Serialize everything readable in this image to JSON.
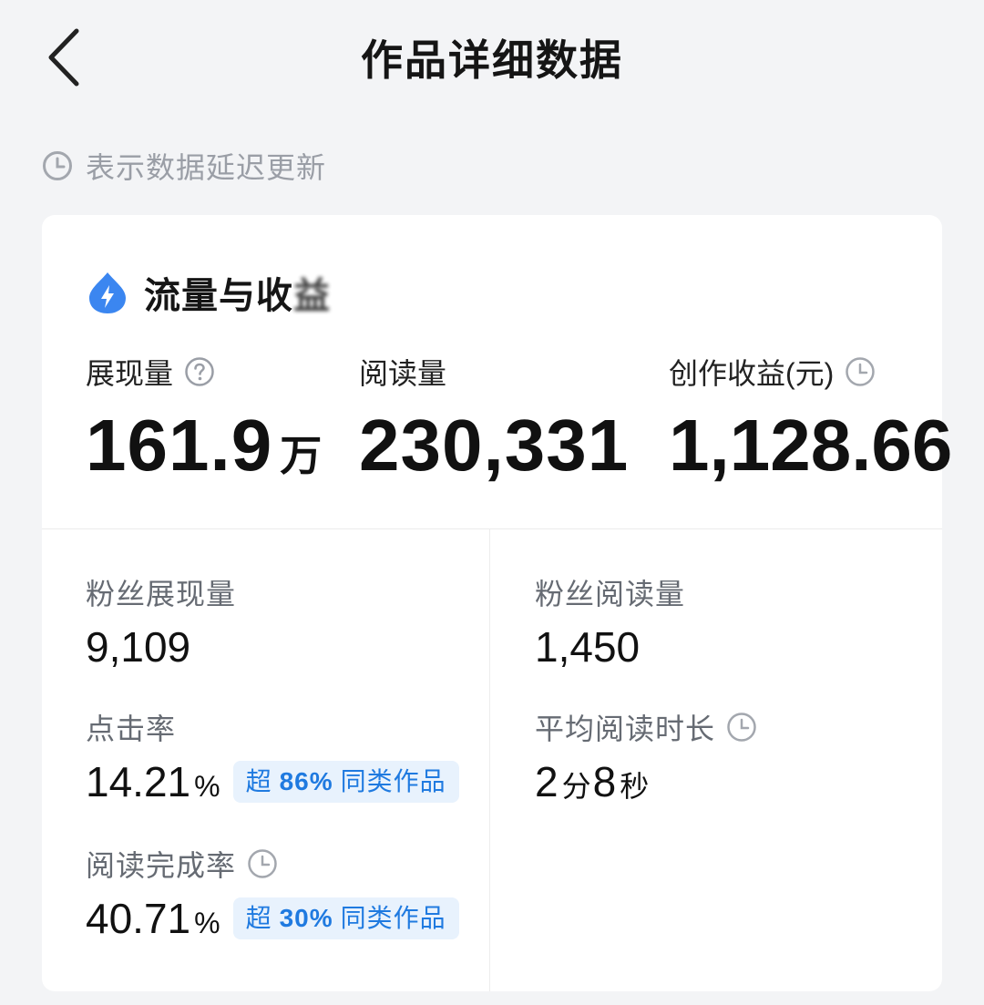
{
  "header": {
    "title": "作品详细数据"
  },
  "notice": {
    "text": "表示数据延迟更新"
  },
  "card": {
    "title": "流量与收",
    "title_blurred_char": "益",
    "metrics": [
      {
        "label": "展现量",
        "value": "161.9",
        "unit": "万"
      },
      {
        "label": "阅读量",
        "value": "230,331"
      },
      {
        "label": "创作收益(元)",
        "value": "1,128.66"
      }
    ],
    "fans_impressions": {
      "label": "粉丝展现量",
      "value": "9,109"
    },
    "fans_reads": {
      "label": "粉丝阅读量",
      "value": "1,450"
    },
    "ctr": {
      "label": "点击率",
      "value": "14.21",
      "unit": "%",
      "badge_prefix": "超",
      "badge_pct": "86%",
      "badge_suffix": "同类作品"
    },
    "avg_read_time": {
      "label": "平均阅读时长",
      "min": "2",
      "min_unit": "分",
      "sec": "8",
      "sec_unit": "秒"
    },
    "completion": {
      "label": "阅读完成率",
      "value": "40.71",
      "unit": "%",
      "badge_prefix": "超",
      "badge_pct": "30%",
      "badge_suffix": "同类作品"
    }
  },
  "colors": {
    "accent": "#1f7ae0",
    "badge_bg": "#e8f2fd",
    "icon_blue": "#3b86f0"
  }
}
